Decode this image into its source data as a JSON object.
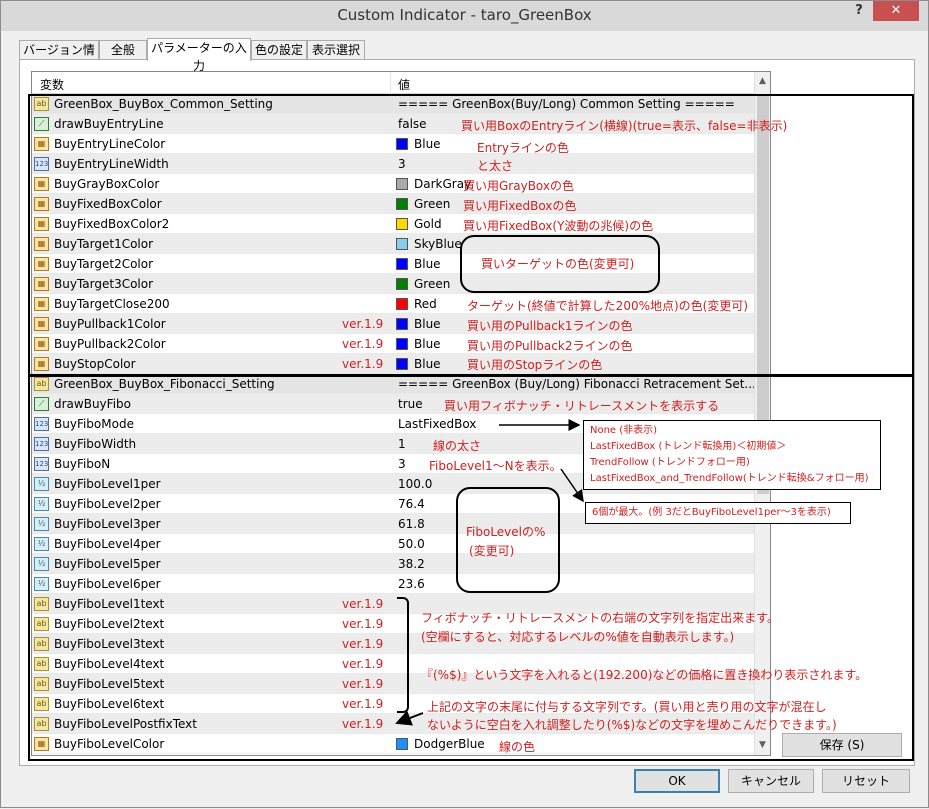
{
  "window": {
    "title": "Custom Indicator - taro_GreenBox",
    "help_label": "?",
    "close_label": "✕"
  },
  "tabs": [
    {
      "label": "バージョン情報"
    },
    {
      "label": "全般"
    },
    {
      "label": "パラメーターの入力"
    },
    {
      "label": "色の設定"
    },
    {
      "label": "表示選択"
    }
  ],
  "grid": {
    "col_variable": "変数",
    "col_value": "値",
    "rows": [
      {
        "icon": "ab",
        "name": "GreenBox_BuyBox_Common_Setting",
        "value": "===== GreenBox(Buy/Long) Common Setting =====",
        "ver": ""
      },
      {
        "icon": "bool",
        "name": "drawBuyEntryLine",
        "value": "false",
        "ver": ""
      },
      {
        "icon": "color",
        "name": "BuyEntryLineColor",
        "value": "Blue",
        "swatch": "#0000ff",
        "ver": ""
      },
      {
        "icon": "123",
        "name": "BuyEntryLineWidth",
        "value": "3",
        "ver": ""
      },
      {
        "icon": "color",
        "name": "BuyGrayBoxColor",
        "value": "DarkGray",
        "swatch": "#a9a9a9",
        "ver": ""
      },
      {
        "icon": "color",
        "name": "BuyFixedBoxColor",
        "value": "Green",
        "swatch": "#008000",
        "ver": ""
      },
      {
        "icon": "color",
        "name": "BuyFixedBoxColor2",
        "value": "Gold",
        "swatch": "#ffd700",
        "ver": ""
      },
      {
        "icon": "color",
        "name": "BuyTarget1Color",
        "value": "SkyBlue",
        "swatch": "#87ceeb",
        "ver": ""
      },
      {
        "icon": "color",
        "name": "BuyTarget2Color",
        "value": "Blue",
        "swatch": "#0000ff",
        "ver": ""
      },
      {
        "icon": "color",
        "name": "BuyTarget3Color",
        "value": "Green",
        "swatch": "#008000",
        "ver": ""
      },
      {
        "icon": "color",
        "name": "BuyTargetClose200",
        "value": "Red",
        "swatch": "#ff0000",
        "ver": ""
      },
      {
        "icon": "color",
        "name": "BuyPullback1Color",
        "value": "Blue",
        "swatch": "#0000ff",
        "ver": "ver.1.9"
      },
      {
        "icon": "color",
        "name": "BuyPullback2Color",
        "value": "Blue",
        "swatch": "#0000ff",
        "ver": "ver.1.9"
      },
      {
        "icon": "color",
        "name": "BuyStopColor",
        "value": "Blue",
        "swatch": "#0000ff",
        "ver": "ver.1.9"
      },
      {
        "icon": "ab",
        "name": "GreenBox_BuyBox_Fibonacci_Setting",
        "value": "===== GreenBox (Buy/Long) Fibonacci Retracement Set...",
        "ver": ""
      },
      {
        "icon": "bool",
        "name": "drawBuyFibo",
        "value": "true",
        "ver": ""
      },
      {
        "icon": "123",
        "name": "BuyFiboMode",
        "value": "LastFixedBox",
        "ver": ""
      },
      {
        "icon": "123",
        "name": "BuyFiboWidth",
        "value": "1",
        "ver": ""
      },
      {
        "icon": "123",
        "name": "BuyFiboN",
        "value": "3",
        "ver": ""
      },
      {
        "icon": "dbl",
        "name": "BuyFiboLevel1per",
        "value": "100.0",
        "ver": ""
      },
      {
        "icon": "dbl",
        "name": "BuyFiboLevel2per",
        "value": "76.4",
        "ver": ""
      },
      {
        "icon": "dbl",
        "name": "BuyFiboLevel3per",
        "value": "61.8",
        "ver": ""
      },
      {
        "icon": "dbl",
        "name": "BuyFiboLevel4per",
        "value": "50.0",
        "ver": ""
      },
      {
        "icon": "dbl",
        "name": "BuyFiboLevel5per",
        "value": "38.2",
        "ver": ""
      },
      {
        "icon": "dbl",
        "name": "BuyFiboLevel6per",
        "value": "23.6",
        "ver": ""
      },
      {
        "icon": "ab",
        "name": "BuyFiboLevel1text",
        "value": "",
        "ver": "ver.1.9"
      },
      {
        "icon": "ab",
        "name": "BuyFiboLevel2text",
        "value": "",
        "ver": "ver.1.9"
      },
      {
        "icon": "ab",
        "name": "BuyFiboLevel3text",
        "value": "",
        "ver": "ver.1.9"
      },
      {
        "icon": "ab",
        "name": "BuyFiboLevel4text",
        "value": "",
        "ver": "ver.1.9"
      },
      {
        "icon": "ab",
        "name": "BuyFiboLevel5text",
        "value": "",
        "ver": "ver.1.9"
      },
      {
        "icon": "ab",
        "name": "BuyFiboLevel6text",
        "value": "",
        "ver": "ver.1.9"
      },
      {
        "icon": "ab",
        "name": "BuyFiboLevelPostfixText",
        "value": "",
        "ver": "ver.1.9"
      },
      {
        "icon": "color",
        "name": "BuyFiboLevelColor",
        "value": "DodgerBlue",
        "swatch": "#1e90ff",
        "ver": ""
      }
    ]
  },
  "annotations": {
    "entry_line": "買い用BoxのEntryライン(横線)(true=表示、false=非表示)",
    "entry_color_1": "Entryラインの色",
    "entry_color_2": "と太さ",
    "graybox": "買い用GrayBoxの色",
    "fixedbox": "買い用FixedBoxの色",
    "fixedbox2": "買い用FixedBox(Y波動の兆候)の色",
    "target": "買いターゲットの色(変更可)",
    "close200": "ターゲット(終値で計算した200%地点)の色(変更可)",
    "pullback1": "買い用のPullback1ラインの色",
    "pullback2": "買い用のPullback2ラインの色",
    "stop": "買い用のStopラインの色",
    "drawfibo": "買い用フィボナッチ・リトレースメントを表示する",
    "fibowidth": "線の太さ",
    "fibon": "FiboLevel1～Nを表示。",
    "fibo_pct_1": "FiboLevelの%",
    "fibo_pct_2": "(変更可)",
    "text_1": "フィボナッチ・リトレースメントの右端の文字列を指定出来ます。",
    "text_2": "(空欄にすると、対応するレベルの%値を自動表示します。)",
    "text_3": "『(%$)』という文字を入れると(192.200)などの価格に置き換わり表示されます。",
    "postfix_1": "上記の文字の末尾に付与する文字列です。(買い用と売り用の文字が混在し",
    "postfix_2": "ないように空白を入れ調整したり(%$)などの文字を埋めこんだりできます。)",
    "fibocolor": "線の色",
    "mode_callout": [
      "None (非表示)",
      "LastFixedBox (トレンド転換用)＜初期値＞",
      "TrendFollow (トレンドフォロー用)",
      "LastFixedBox_and_TrendFollow(トレンド転換&フォロー用)"
    ],
    "n_callout": "6個が最大。(例 3だとBuyFiboLevel1per～3を表示)"
  },
  "buttons": {
    "save": "保存 (S)",
    "ok": "OK",
    "cancel": "キャンセル",
    "reset": "リセット"
  }
}
